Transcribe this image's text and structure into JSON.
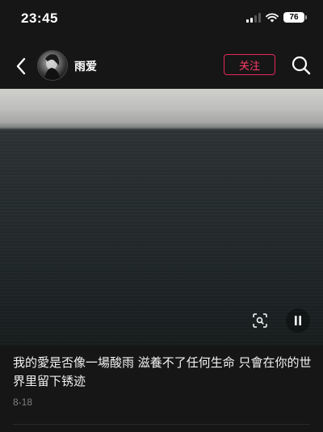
{
  "status_bar": {
    "time": "23:45",
    "battery": "76",
    "icons": [
      "signal-icon",
      "wifi-icon",
      "battery-icon"
    ]
  },
  "nav": {
    "back_icon": "chevron-left-icon",
    "username": "雨爱",
    "follow_label": "关注",
    "search_icon": "search-icon"
  },
  "video": {
    "controls": [
      "scan-icon",
      "pause-icon"
    ]
  },
  "post": {
    "caption": "我的愛是否像一場酸雨 滋養不了任何生命 只會在你的世界里留下锈迹",
    "date": "8-18"
  },
  "colors": {
    "background": "#161616",
    "follow_accent": "#ff3b6b",
    "date_text": "#7f7f7f"
  }
}
